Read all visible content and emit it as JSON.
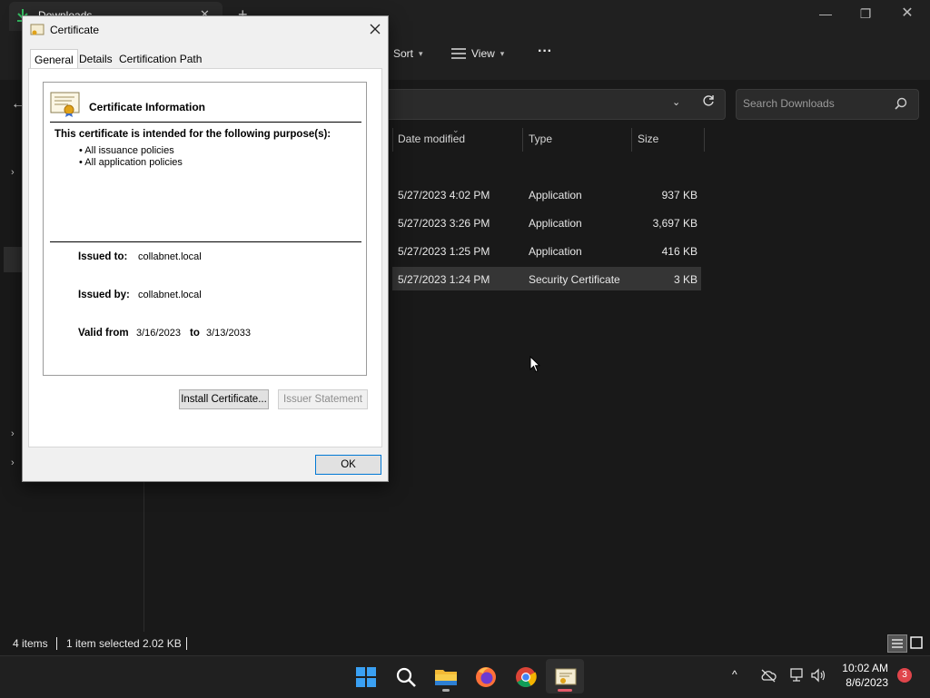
{
  "explorer": {
    "tab_title": "Downloads",
    "toolbar": {
      "sort_label": "Sort",
      "view_label": "View",
      "more_label": "···"
    },
    "search_placeholder": "Search Downloads",
    "columns": [
      "Date modified",
      "Type",
      "Size"
    ],
    "rows": [
      {
        "date": "5/27/2023 4:02 PM",
        "type": "Application",
        "size": "937 KB",
        "selected": false
      },
      {
        "date": "5/27/2023 3:26 PM",
        "type": "Application",
        "size": "3,697 KB",
        "selected": false
      },
      {
        "date": "5/27/2023 1:25 PM",
        "type": "Application",
        "size": "416 KB",
        "selected": false
      },
      {
        "date": "5/27/2023 1:24 PM",
        "type": "Security Certificate",
        "size": "3 KB",
        "selected": true
      }
    ],
    "status": {
      "items": "4 items",
      "selected": "1 item selected",
      "size": "2.02 KB"
    }
  },
  "dialog": {
    "title": "Certificate",
    "tabs": [
      "General",
      "Details",
      "Certification Path"
    ],
    "active_tab": 0,
    "info_title": "Certificate Information",
    "purpose_heading": "This certificate is intended for the following purpose(s):",
    "purposes": [
      "• All issuance policies",
      "• All application policies"
    ],
    "issued_to_label": "Issued to:",
    "issued_to": "collabnet.local",
    "issued_by_label": "Issued by:",
    "issued_by": "collabnet.local",
    "valid_from_label": "Valid from",
    "valid_from": "3/16/2023",
    "valid_to_label": "to",
    "valid_to": "3/13/2033",
    "install_button": "Install Certificate...",
    "issuer_statement_button": "Issuer Statement",
    "ok_button": "OK"
  },
  "taskbar": {
    "time": "10:02 AM",
    "date": "8/6/2023",
    "notification_count": "3",
    "icons": [
      "windows-start-icon",
      "search-icon",
      "file-explorer-icon",
      "firefox-icon",
      "chrome-icon",
      "certificate-app-icon"
    ]
  },
  "colors": {
    "accent": "#0078d4",
    "dark_bg": "#191919",
    "dialog_bg": "#f0f0f0",
    "notif_badge": "#e0454b"
  }
}
